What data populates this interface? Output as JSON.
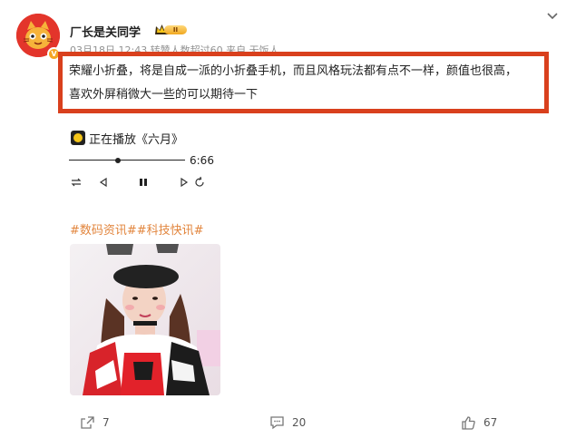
{
  "author": {
    "name": "厂长是关同学",
    "vip_level": "II",
    "verified_badge": "V"
  },
  "post": {
    "meta": "03月18日 12:43 转赞人数超过60  来自 无饭人",
    "text_line1": "荣耀小折叠，将是自成一派的小折叠手机，而且风格玩法都有点不一样，颜值也很高，",
    "text_line2": "喜欢外屏稍微大一些的可以期待一下"
  },
  "music": {
    "now_playing": "正在播放《六月》",
    "duration": "6:66",
    "progress": 0.42
  },
  "tags": "#数码资讯##科技快讯#",
  "actions": {
    "share_count": "7",
    "comment_count": "20",
    "like_count": "67"
  },
  "colors": {
    "highlight": "#d9401d",
    "tag": "#e2853d",
    "avatar_bg": "#e3352b"
  },
  "icons": [
    "collapse-chevron-icon",
    "repeat-icon",
    "previous-icon",
    "pause-icon",
    "next-icon",
    "loop-icon",
    "share-icon",
    "comment-icon",
    "like-icon"
  ]
}
